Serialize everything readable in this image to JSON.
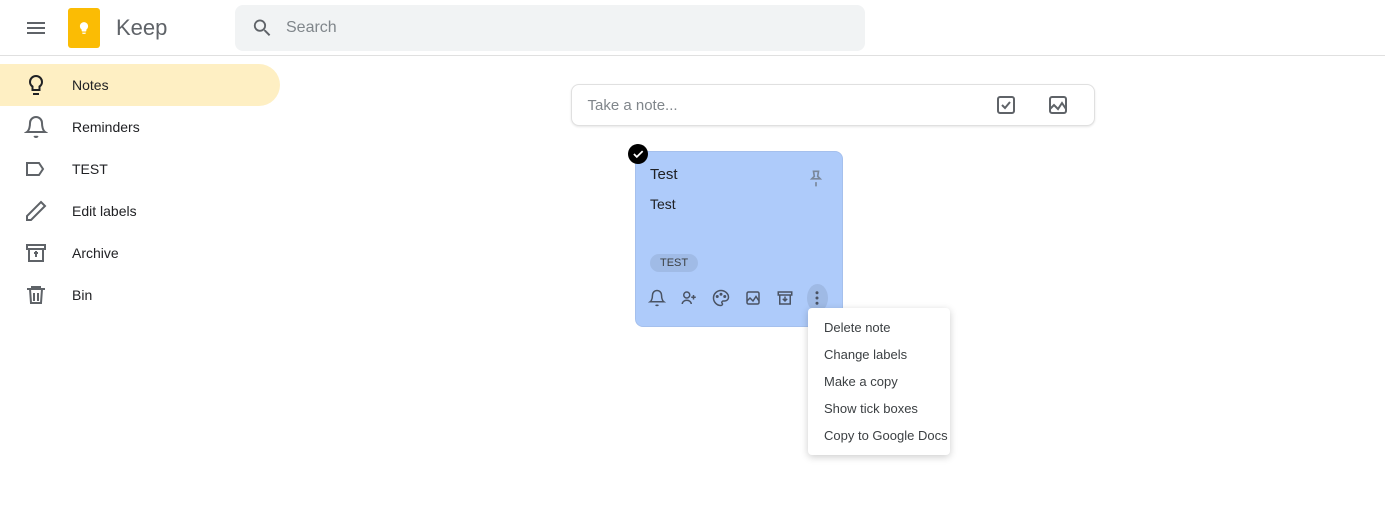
{
  "header": {
    "brand": "Keep",
    "search_placeholder": "Search"
  },
  "sidebar": {
    "items": [
      {
        "label": "Notes",
        "icon": "lightbulb"
      },
      {
        "label": "Reminders",
        "icon": "bell"
      },
      {
        "label": "TEST",
        "icon": "label"
      },
      {
        "label": "Edit labels",
        "icon": "pencil"
      },
      {
        "label": "Archive",
        "icon": "archive"
      },
      {
        "label": "Bin",
        "icon": "trash"
      }
    ]
  },
  "take_note": {
    "placeholder": "Take a note..."
  },
  "note": {
    "title": "Test",
    "body": "Test",
    "label": "TEST"
  },
  "context_menu": {
    "items": [
      "Delete note",
      "Change labels",
      "Make a copy",
      "Show tick boxes",
      "Copy to Google Docs"
    ]
  }
}
